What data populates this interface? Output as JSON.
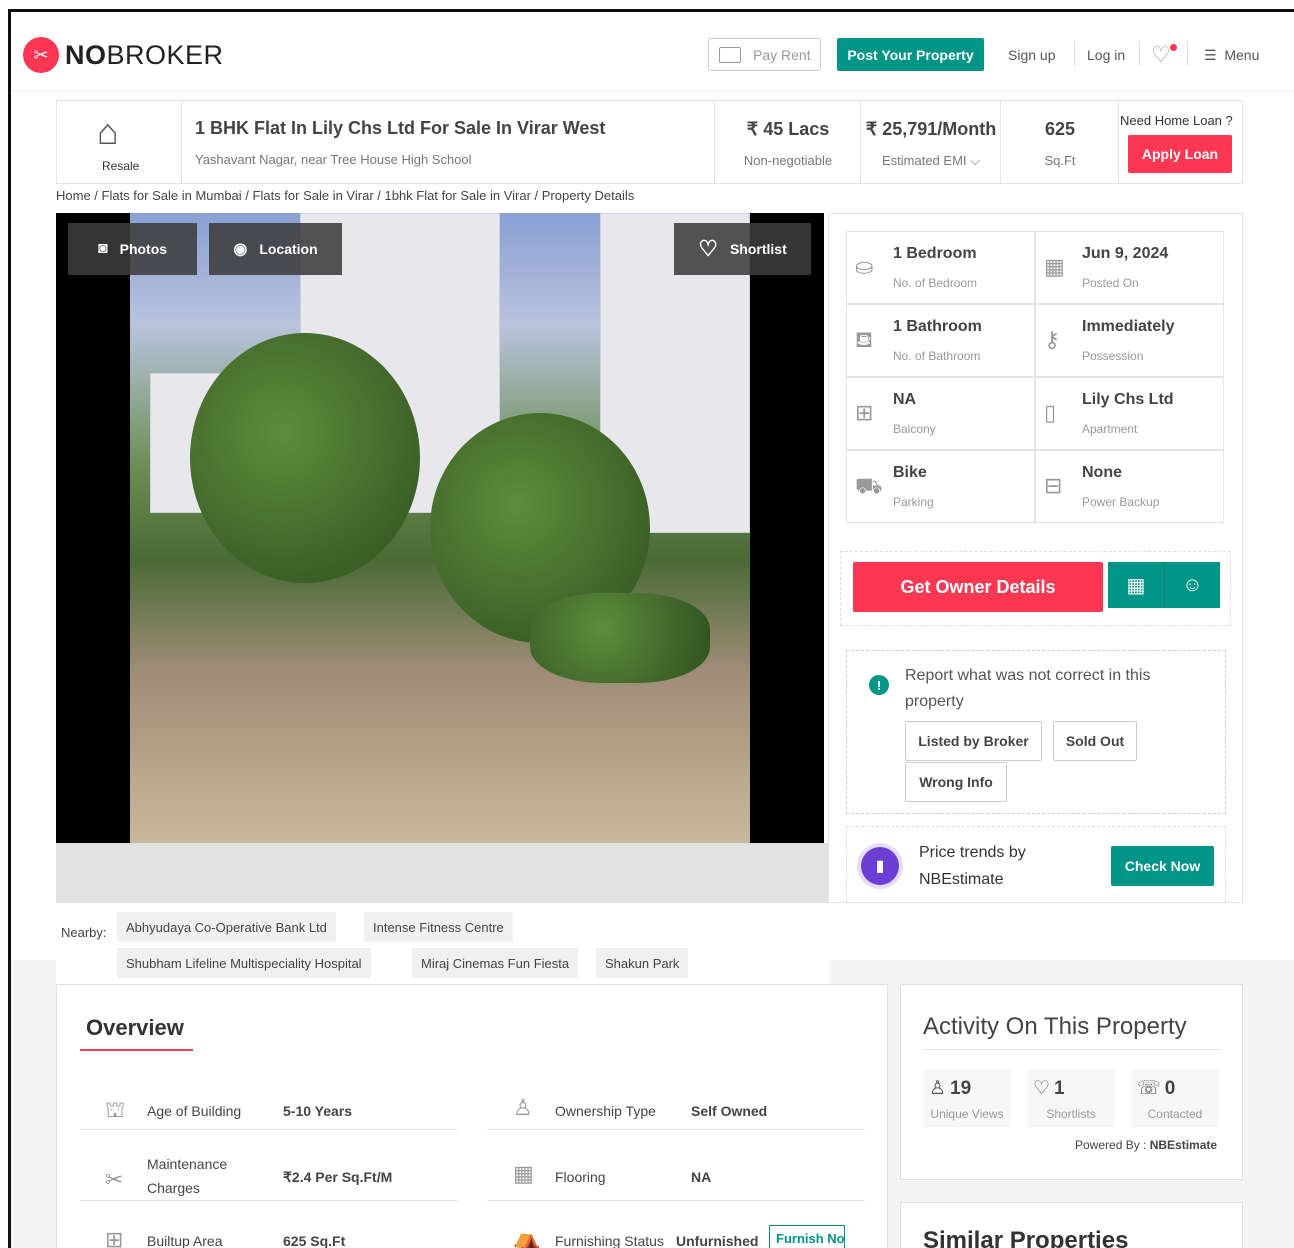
{
  "header": {
    "logo": "NOBROKER",
    "logo_bold": "NO",
    "logo_rest": "BROKER",
    "pay_rent": "Pay Rent",
    "post_property": "Post Your Property",
    "sign_up": "Sign up",
    "log_in": "Log in",
    "menu": "Menu"
  },
  "property": {
    "type_label": "Resale",
    "title": "1 BHK Flat In Lily Chs Ltd For Sale In Virar West",
    "address": "Yashavant Nagar, near Tree House High School",
    "price": "₹ 45 Lacs",
    "price_note": "Non-negotiable",
    "emi": "₹ 25,791/Month",
    "emi_label": "Estimated EMI",
    "area": "625",
    "area_unit": "Sq.Ft",
    "loan_question": "Need Home Loan ?",
    "apply_loan": "Apply Loan"
  },
  "breadcrumb": "Home / Flats for Sale in Mumbai / Flats for Sale in Virar / 1bhk Flat for Sale in Virar / Property Details",
  "gallery": {
    "photos": "Photos",
    "location": "Location",
    "shortlist": "Shortlist"
  },
  "details": [
    {
      "value": "1 Bedroom",
      "label": "No. of Bedroom",
      "icon": "bed-icon"
    },
    {
      "value": "Jun 9, 2024",
      "label": "Posted On",
      "icon": "calendar-icon"
    },
    {
      "value": "1 Bathroom",
      "label": "No. of Bathroom",
      "icon": "bathtub-icon"
    },
    {
      "value": "Immediately",
      "label": "Possession",
      "icon": "key-icon"
    },
    {
      "value": "NA",
      "label": "Balcony",
      "icon": "balcony-icon"
    },
    {
      "value": "Lily Chs Ltd",
      "label": "Apartment",
      "icon": "building-icon"
    },
    {
      "value": "Bike",
      "label": "Parking",
      "icon": "car-icon"
    },
    {
      "value": "None",
      "label": "Power Backup",
      "icon": "battery-icon"
    }
  ],
  "actions": {
    "get_owner": "Get Owner Details"
  },
  "report": {
    "text": "Report what was not correct in this property",
    "chips": [
      "Listed by Broker",
      "Sold Out",
      "Wrong Info"
    ]
  },
  "trends": {
    "line1": "Price trends by",
    "line2": "NBEstimate",
    "check_now": "Check Now"
  },
  "nearby": {
    "label": "Nearby:",
    "places": [
      "Abhyudaya Co-Operative Bank Ltd",
      "Intense Fitness Centre",
      "Shubham Lifeline Multispeciality Hospital",
      "Miraj Cinemas Fun Fiesta",
      "Shakun Park"
    ]
  },
  "overview": {
    "title": "Overview",
    "rows": [
      {
        "label": "Age of Building",
        "value": "5-10 Years"
      },
      {
        "label": "Ownership Type",
        "value": "Self Owned"
      },
      {
        "label": "Maintenance Charges",
        "value": "₹2.4 Per Sq.Ft/M"
      },
      {
        "label": "Flooring",
        "value": "NA"
      },
      {
        "label": "Builtup Area",
        "value": "625 Sq.Ft"
      },
      {
        "label": "Furnishing Status",
        "value": "Unfurnished"
      }
    ],
    "furnish_now": "Furnish Now"
  },
  "activity": {
    "title": "Activity On This Property",
    "stats": [
      {
        "value": "19",
        "label": "Unique Views"
      },
      {
        "value": "1",
        "label": "Shortlists"
      },
      {
        "value": "0",
        "label": "Contacted"
      }
    ],
    "powered_label": "Powered By :",
    "powered_by": "NBEstimate"
  },
  "similar": {
    "title": "Similar Properties"
  },
  "colors": {
    "brand_red": "#fd3752",
    "brand_green": "#009587"
  }
}
